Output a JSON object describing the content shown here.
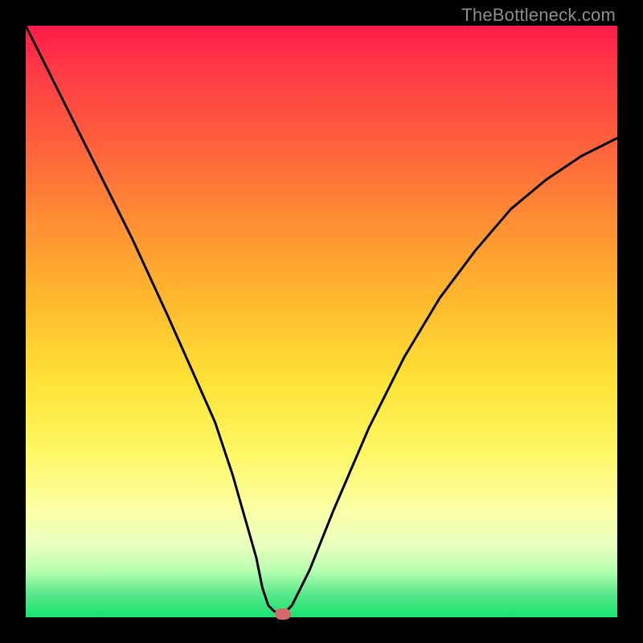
{
  "watermark": "TheBottleneck.com",
  "colors": {
    "frame": "#000000",
    "watermark": "#8d8d8d",
    "curve": "#000000",
    "marker": "#d46a6c",
    "gradient_stops": [
      "#ff1a4b",
      "#ff3548",
      "#ff5a3e",
      "#ff8a34",
      "#ffb82e",
      "#ffe236",
      "#fff765",
      "#fbffa6",
      "#e8ffc0",
      "#baffb1",
      "#5be88d",
      "#18e26e"
    ]
  },
  "chart_data": {
    "type": "line",
    "title": "",
    "xlabel": "",
    "ylabel": "",
    "xlim": [
      0,
      100
    ],
    "ylim": [
      0,
      100
    ],
    "grid": false,
    "legend": false,
    "series": [
      {
        "name": "bottleneck-curve",
        "x": [
          0,
          6,
          12,
          18,
          24,
          28,
          32,
          35,
          37,
          39,
          40,
          41,
          42,
          43.5,
          45,
          48,
          52,
          58,
          64,
          70,
          76,
          82,
          88,
          94,
          100
        ],
        "values": [
          100,
          88,
          76,
          64,
          51,
          42,
          33,
          24,
          17,
          10,
          5,
          2,
          1,
          0.5,
          2,
          8,
          18,
          32,
          44,
          54,
          62,
          69,
          74,
          78,
          81
        ]
      }
    ],
    "annotations": [
      {
        "name": "min-marker",
        "x": 43.5,
        "y": 0.5
      }
    ],
    "notes": "V-shaped bottleneck curve over vertical red→green gradient. Values estimated from pixels; chart has no visible axes, ticks, or labels."
  }
}
